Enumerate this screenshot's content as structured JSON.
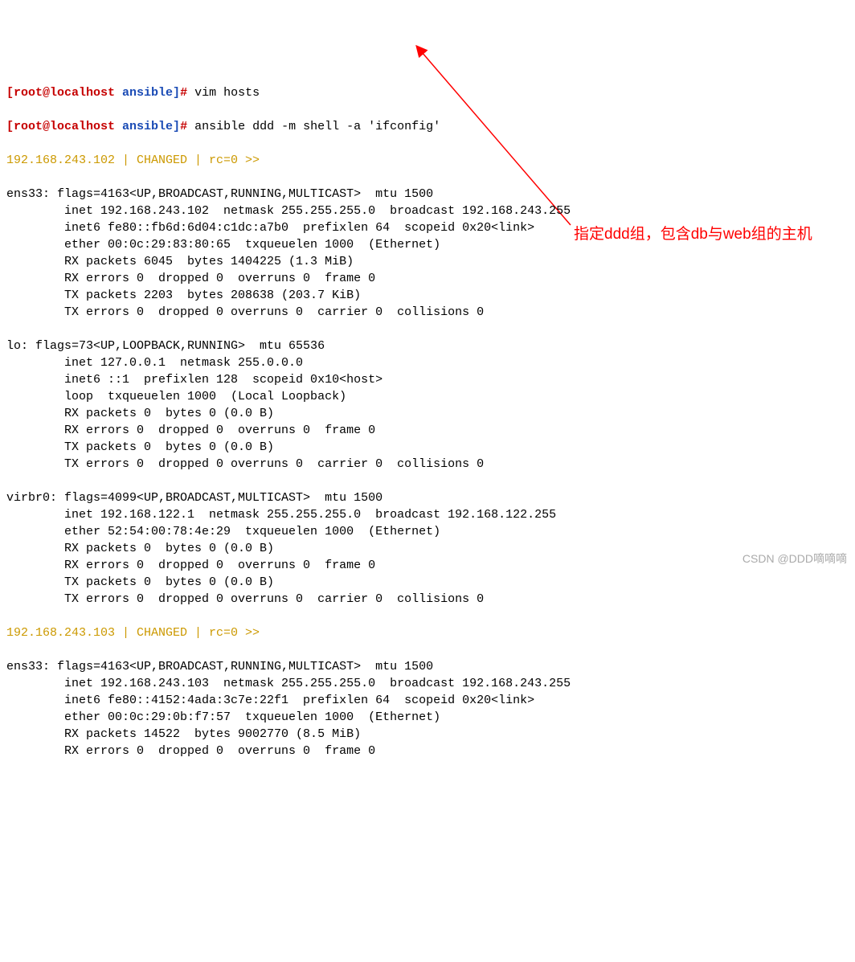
{
  "partial_prev": {
    "prompt_user_host": "[root@localhost",
    "prompt_path": "ansible]",
    "prompt_hash": "#",
    "command": "vim hosts"
  },
  "command_line": {
    "prompt_user_host": "[root@localhost",
    "prompt_path": "ansible]",
    "prompt_hash": "#",
    "command": "ansible ddd -m shell -a 'ifconfig'"
  },
  "output1": {
    "host_status": "192.168.243.102 | CHANGED | rc=0 >>",
    "lines": [
      "ens33: flags=4163<UP,BROADCAST,RUNNING,MULTICAST>  mtu 1500",
      "        inet 192.168.243.102  netmask 255.255.255.0  broadcast 192.168.243.255",
      "        inet6 fe80::fb6d:6d04:c1dc:a7b0  prefixlen 64  scopeid 0x20<link>",
      "        ether 00:0c:29:83:80:65  txqueuelen 1000  (Ethernet)",
      "        RX packets 6045  bytes 1404225 (1.3 MiB)",
      "        RX errors 0  dropped 0  overruns 0  frame 0",
      "        TX packets 2203  bytes 208638 (203.7 KiB)",
      "        TX errors 0  dropped 0 overruns 0  carrier 0  collisions 0",
      "",
      "lo: flags=73<UP,LOOPBACK,RUNNING>  mtu 65536",
      "        inet 127.0.0.1  netmask 255.0.0.0",
      "        inet6 ::1  prefixlen 128  scopeid 0x10<host>",
      "        loop  txqueuelen 1000  (Local Loopback)",
      "        RX packets 0  bytes 0 (0.0 B)",
      "        RX errors 0  dropped 0  overruns 0  frame 0",
      "        TX packets 0  bytes 0 (0.0 B)",
      "        TX errors 0  dropped 0 overruns 0  carrier 0  collisions 0",
      "",
      "virbr0: flags=4099<UP,BROADCAST,MULTICAST>  mtu 1500",
      "        inet 192.168.122.1  netmask 255.255.255.0  broadcast 192.168.122.255",
      "        ether 52:54:00:78:4e:29  txqueuelen 1000  (Ethernet)",
      "        RX packets 0  bytes 0 (0.0 B)",
      "        RX errors 0  dropped 0  overruns 0  frame 0",
      "        TX packets 0  bytes 0 (0.0 B)",
      "        TX errors 0  dropped 0 overruns 0  carrier 0  collisions 0"
    ]
  },
  "output2": {
    "host_status": "192.168.243.103 | CHANGED | rc=0 >>",
    "lines": [
      "ens33: flags=4163<UP,BROADCAST,RUNNING,MULTICAST>  mtu 1500",
      "        inet 192.168.243.103  netmask 255.255.255.0  broadcast 192.168.243.255",
      "        inet6 fe80::4152:4ada:3c7e:22f1  prefixlen 64  scopeid 0x20<link>",
      "        ether 00:0c:29:0b:f7:57  txqueuelen 1000  (Ethernet)",
      "        RX packets 14522  bytes 9002770 (8.5 MiB)",
      "        RX errors 0  dropped 0  overruns 0  frame 0"
    ]
  },
  "annotation": {
    "text": "指定ddd组，包含db与web组的主机"
  },
  "watermark": {
    "text": "CSDN @DDD嘀嘀嘀"
  }
}
